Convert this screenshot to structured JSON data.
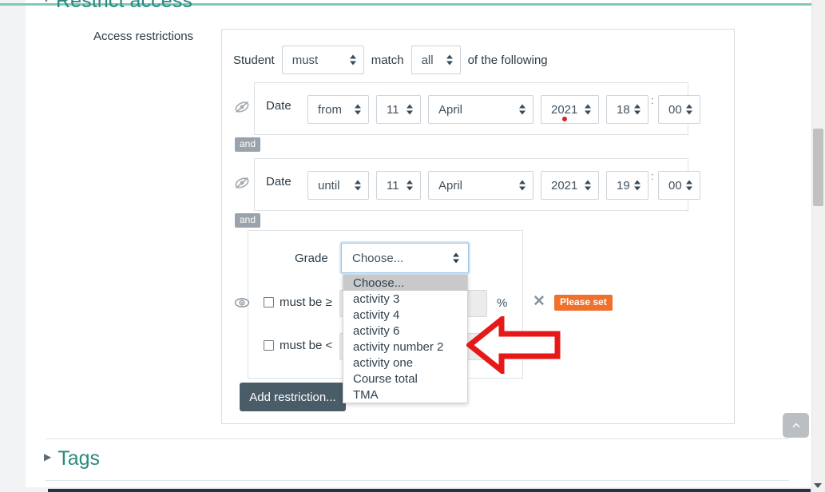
{
  "page": {
    "section_heading": "Restrict access",
    "field_label": "Access restrictions",
    "tags_heading": "Tags",
    "caret_collapsed": "▶",
    "caret_expanded": "▼"
  },
  "colors": {
    "heading_teal": "#2a8a7e",
    "top_rule_teal": "#7fc9bd",
    "badge_orange": "#f0712b",
    "button_slate": "#495c68",
    "and_badge_grey": "#9aa3ab",
    "focus_blue": "#9ec5e8",
    "annotation_red": "#e61919",
    "required_dot_red": "#e02020"
  },
  "student_line": {
    "prefix": "Student",
    "must_value": "must",
    "match_word": "match",
    "all_value": "all",
    "suffix": "of the following"
  },
  "conditions": [
    {
      "type": "date",
      "visibility_icon": "eye-slash-icon",
      "label": "Date",
      "direction": "from",
      "day": "11",
      "month": "April",
      "year": "2021",
      "hour": "18",
      "minute": "00",
      "separator": ":",
      "remove_label": "✕",
      "operator_badge": "and",
      "has_required_dot": true
    },
    {
      "type": "date",
      "visibility_icon": "eye-slash-icon",
      "label": "Date",
      "direction": "until",
      "day": "11",
      "month": "April",
      "year": "2021",
      "hour": "19",
      "minute": "00",
      "separator": ":",
      "remove_label": "✕",
      "operator_badge": "and",
      "has_required_dot": false
    }
  ],
  "grade_condition": {
    "visibility_icon": "eye-icon",
    "label": "Grade",
    "selected_value": "Choose...",
    "remove_label": "✕",
    "status_badge": "Please set",
    "options": [
      "Choose...",
      "activity 3",
      "activity 4",
      "activity 6",
      "activity number 2",
      "activity one",
      "Course total",
      "TMA"
    ],
    "min_row": {
      "label": "must be ≥",
      "value": "",
      "unit": "%",
      "checked": false
    },
    "max_row": {
      "label": "must be <",
      "value": "",
      "unit": "%",
      "checked": false
    }
  },
  "add_restriction_button": "Add restriction...",
  "chrome": {
    "scroll_to_top_icon": "chevron-up-icon",
    "scrollbar_down_icon": "triangle-down-icon"
  },
  "annotation": {
    "type": "left-arrow",
    "color": "#e61919"
  }
}
